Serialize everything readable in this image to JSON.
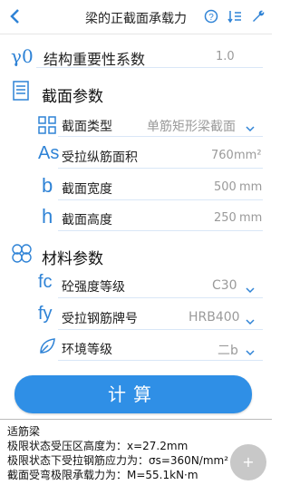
{
  "header": {
    "back_icon": "back-chevron-icon",
    "title": "梁的正截面承载力",
    "icons": [
      "help-icon",
      "sort-icon",
      "wrench-icon"
    ]
  },
  "gamma0": {
    "symbol": "γ0",
    "label": "结构重要性系数",
    "value": "1.0"
  },
  "section": {
    "title": "截面参数",
    "type": {
      "label": "截面类型",
      "value": "单筋矩形梁截面"
    },
    "as": {
      "symbol": "As",
      "label": "受拉纵筋面积",
      "value": "760",
      "unit": "mm²"
    },
    "b": {
      "symbol": "b",
      "label": "截面宽度",
      "value": "500",
      "unit": "mm"
    },
    "h": {
      "symbol": "h",
      "label": "截面高度",
      "value": "250",
      "unit": "mm"
    }
  },
  "material": {
    "title": "材料参数",
    "fc": {
      "symbol": "fc",
      "label": "砼强度等级",
      "value": "C30"
    },
    "fy": {
      "symbol": "fy",
      "label": "受拉钢筋牌号",
      "value": "HRB400"
    },
    "env": {
      "label": "环境等级",
      "value": "二b"
    }
  },
  "button": {
    "label": "计算"
  },
  "result": {
    "line1": "适筋梁",
    "line2": "极限状态受压区高度为：x=27.2mm",
    "line3": "极限状态下受拉钢筋应力为：σs=360N/mm²",
    "line4": "截面受弯极限承载力为：M=55.1kN·m"
  },
  "colors": {
    "accent": "#2f83d6",
    "button": "#2f8fe6"
  }
}
